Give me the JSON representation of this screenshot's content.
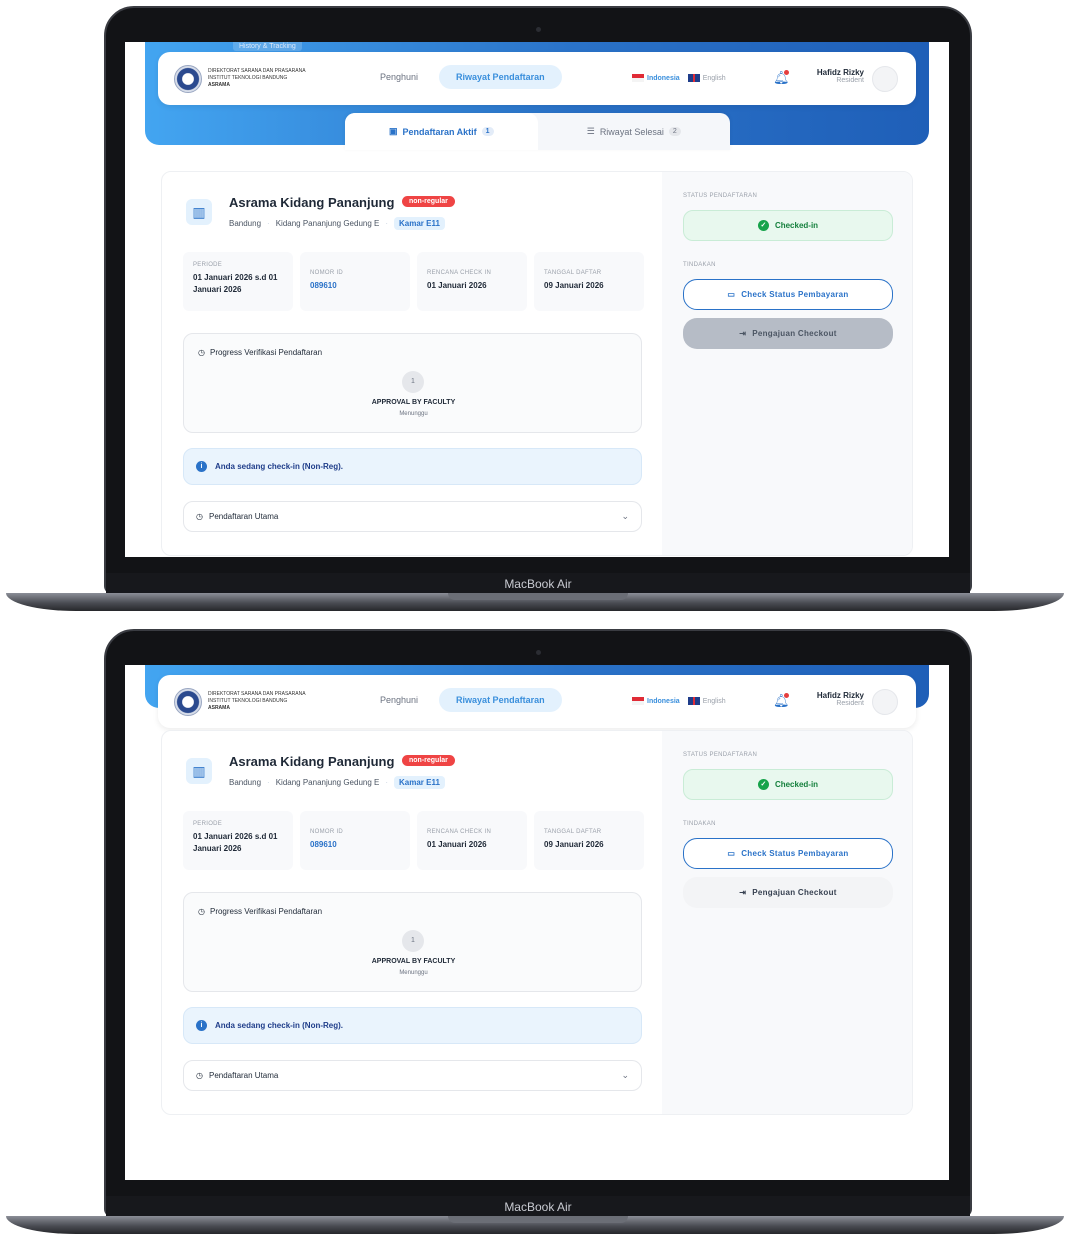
{
  "device": {
    "label": "MacBook Air"
  },
  "hero": {
    "tag": "History & Tracking"
  },
  "org": {
    "line1": "DIREKTORAT SARANA DAN PRASARANA",
    "line2": "INSTITUT TEKNOLOGI BANDUNG",
    "line3": "ASRAMA"
  },
  "nav": {
    "items": [
      {
        "label": "Penghuni"
      },
      {
        "label": "Riwayat Pendaftaran"
      }
    ]
  },
  "lang": {
    "id": "Indonesia",
    "en": "English"
  },
  "user": {
    "name": "Hafidz Rizky",
    "role": "Resident"
  },
  "tabs": [
    {
      "label": "Pendaftaran Aktif",
      "count": "1"
    },
    {
      "label": "Riwayat Selesai",
      "count": "2"
    }
  ],
  "dorm": {
    "name": "Asrama Kidang Pananjung",
    "badge": "non-regular",
    "city": "Bandung",
    "building": "Kidang Pananjung Gedung E",
    "room": "Kamar E11"
  },
  "info": [
    {
      "key": "PERIODE",
      "value": "01 Januari 2026 s.d 01 Januari 2026"
    },
    {
      "key": "NOMOR ID",
      "value": "089610"
    },
    {
      "key": "RENCANA CHECK IN",
      "value": "01 Januari 2026"
    },
    {
      "key": "TANGGAL DAFTAR",
      "value": "09 Januari 2026"
    }
  ],
  "progress": {
    "title": "Progress Verifikasi Pendaftaran",
    "step_number": "1",
    "step_label": "APPROVAL BY FACULTY",
    "step_status": "Menunggu"
  },
  "alert": {
    "text": "Anda sedang check-in (Non-Reg)."
  },
  "accordion": {
    "label": "Pendaftaran Utama"
  },
  "side": {
    "status_title": "STATUS PENDAFTARAN",
    "status": "Checked-in",
    "actions_title": "TINDAKAN",
    "pay_button": "Check Status Pembayaran",
    "checkout_button": "Pengajuan Checkout"
  }
}
